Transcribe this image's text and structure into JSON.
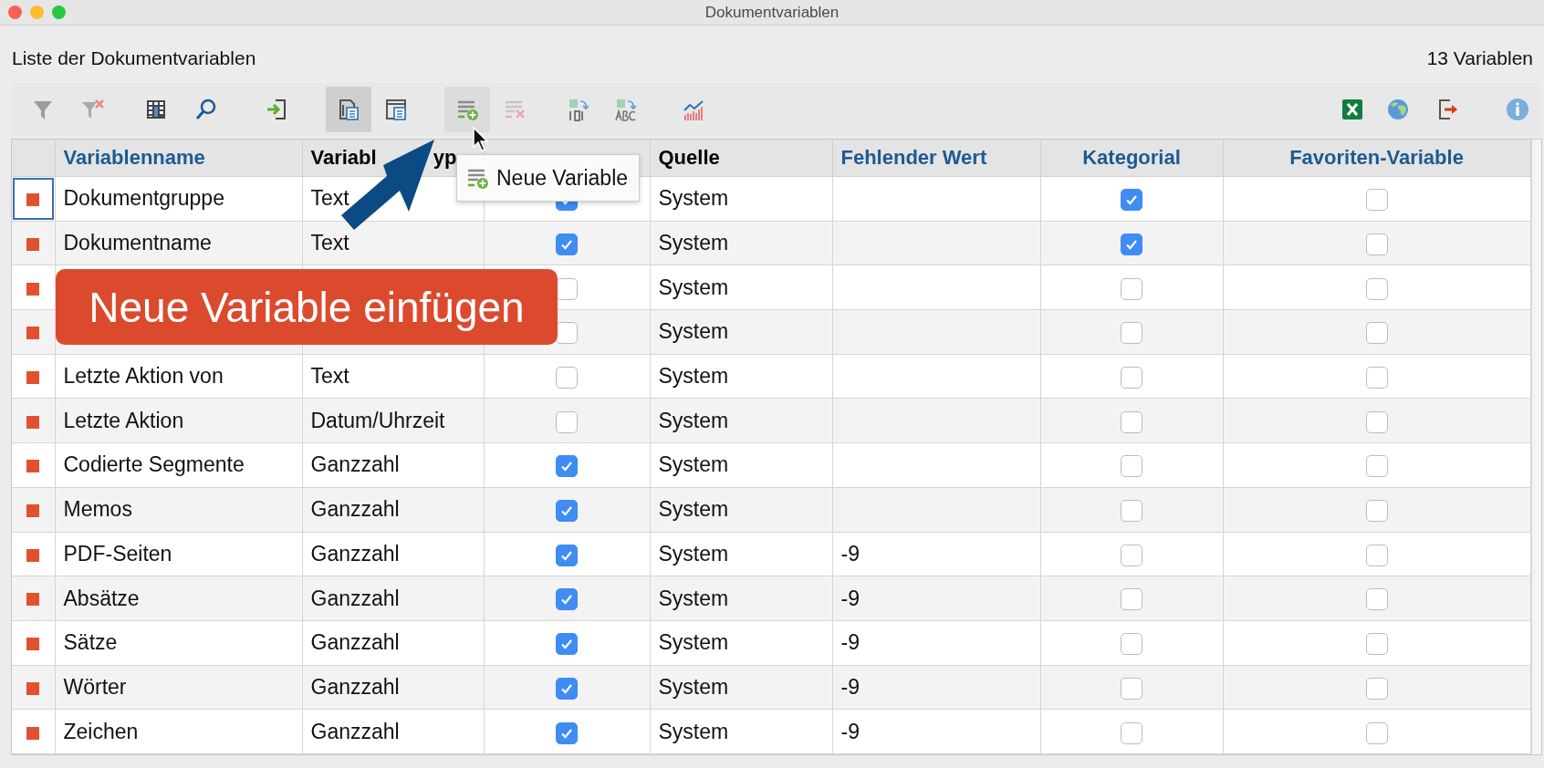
{
  "window": {
    "title": "Dokumentvariablen"
  },
  "list_title": "Liste der Dokumentvariablen",
  "count": "13 Variablen",
  "toolbar": [
    {
      "kind": "filter",
      "disabled": true,
      "selected": false
    },
    {
      "kind": "filter-clear",
      "disabled": true,
      "selected": false
    },
    {
      "kind": "table",
      "disabled": false,
      "selected": false
    },
    {
      "kind": "search",
      "disabled": false,
      "selected": false
    },
    {
      "kind": "import",
      "disabled": false,
      "selected": false
    },
    {
      "kind": "doc-list",
      "disabled": false,
      "selected": true
    },
    {
      "kind": "doc-window",
      "disabled": false,
      "selected": false
    },
    {
      "kind": "add-variable",
      "disabled": false,
      "selected": false,
      "hovered": true
    },
    {
      "kind": "delete-variable",
      "disabled": true,
      "selected": false
    },
    {
      "kind": "to-number",
      "disabled": false,
      "selected": false
    },
    {
      "kind": "to-text",
      "disabled": false,
      "selected": false
    },
    {
      "kind": "chart",
      "disabled": false,
      "selected": false
    },
    {
      "kind": "excel",
      "disabled": false,
      "selected": false
    },
    {
      "kind": "globe",
      "disabled": false,
      "selected": false
    },
    {
      "kind": "export",
      "disabled": false,
      "selected": false
    },
    {
      "kind": "info",
      "disabled": false,
      "selected": false
    }
  ],
  "tooltip": {
    "label": "Neue Variable"
  },
  "callout": "Neue Variable einfügen",
  "table": {
    "columns": [
      {
        "label": "Variablenname",
        "color": "#1d5a92"
      },
      {
        "label": "Variabl",
        "label_end": "yp",
        "color": "#000000"
      },
      null,
      {
        "label": "Quelle",
        "color": "#000000"
      },
      {
        "label": "Fehlender Wert",
        "color": "#1d5a92"
      },
      {
        "label": "Kategorial",
        "color": "#1d5a92"
      },
      {
        "label": "Favoriten-Variable",
        "color": "#1d5a92"
      }
    ],
    "rows": [
      {
        "name": "Dokumentgruppe",
        "type": "Text",
        "visible": true,
        "source": "System",
        "categorical": true,
        "favorite": false,
        "focused": true
      },
      {
        "name": "Dokumentname",
        "type": "Text",
        "visible": true,
        "source": "System",
        "categorical": true,
        "favorite": false,
        "focused": false
      },
      {
        "visible": false,
        "source": "System",
        "categorical": false,
        "favorite": false,
        "focused": false
      },
      {
        "visible": false,
        "source": "System",
        "categorical": false,
        "favorite": false,
        "focused": false
      },
      {
        "name": "Letzte Aktion von",
        "type": "Text",
        "visible": false,
        "source": "System",
        "categorical": false,
        "favorite": false,
        "focused": false
      },
      {
        "name": "Letzte Aktion",
        "type": "Datum/Uhrzeit",
        "visible": false,
        "source": "System",
        "categorical": false,
        "favorite": false,
        "focused": false
      },
      {
        "name": "Codierte Segmente",
        "type": "Ganzzahl",
        "visible": true,
        "source": "System",
        "categorical": false,
        "favorite": false,
        "focused": false
      },
      {
        "name": "Memos",
        "type": "Ganzzahl",
        "visible": true,
        "source": "System",
        "categorical": false,
        "favorite": false,
        "focused": false
      },
      {
        "name": "PDF-Seiten",
        "type": "Ganzzahl",
        "visible": true,
        "source": "System",
        "missing": "-9",
        "categorical": false,
        "favorite": false,
        "focused": false
      },
      {
        "name": "Absätze",
        "type": "Ganzzahl",
        "visible": true,
        "source": "System",
        "missing": "-9",
        "categorical": false,
        "favorite": false,
        "focused": false
      },
      {
        "name": "Sätze",
        "type": "Ganzzahl",
        "visible": true,
        "source": "System",
        "missing": "-9",
        "categorical": false,
        "favorite": false,
        "focused": false
      },
      {
        "name": "Wörter",
        "type": "Ganzzahl",
        "visible": true,
        "source": "System",
        "missing": "-9",
        "categorical": false,
        "favorite": false,
        "focused": false
      },
      {
        "name": "Zeichen",
        "type": "Ganzzahl",
        "visible": true,
        "source": "System",
        "missing": "-9",
        "categorical": false,
        "favorite": false,
        "focused": false
      }
    ]
  }
}
